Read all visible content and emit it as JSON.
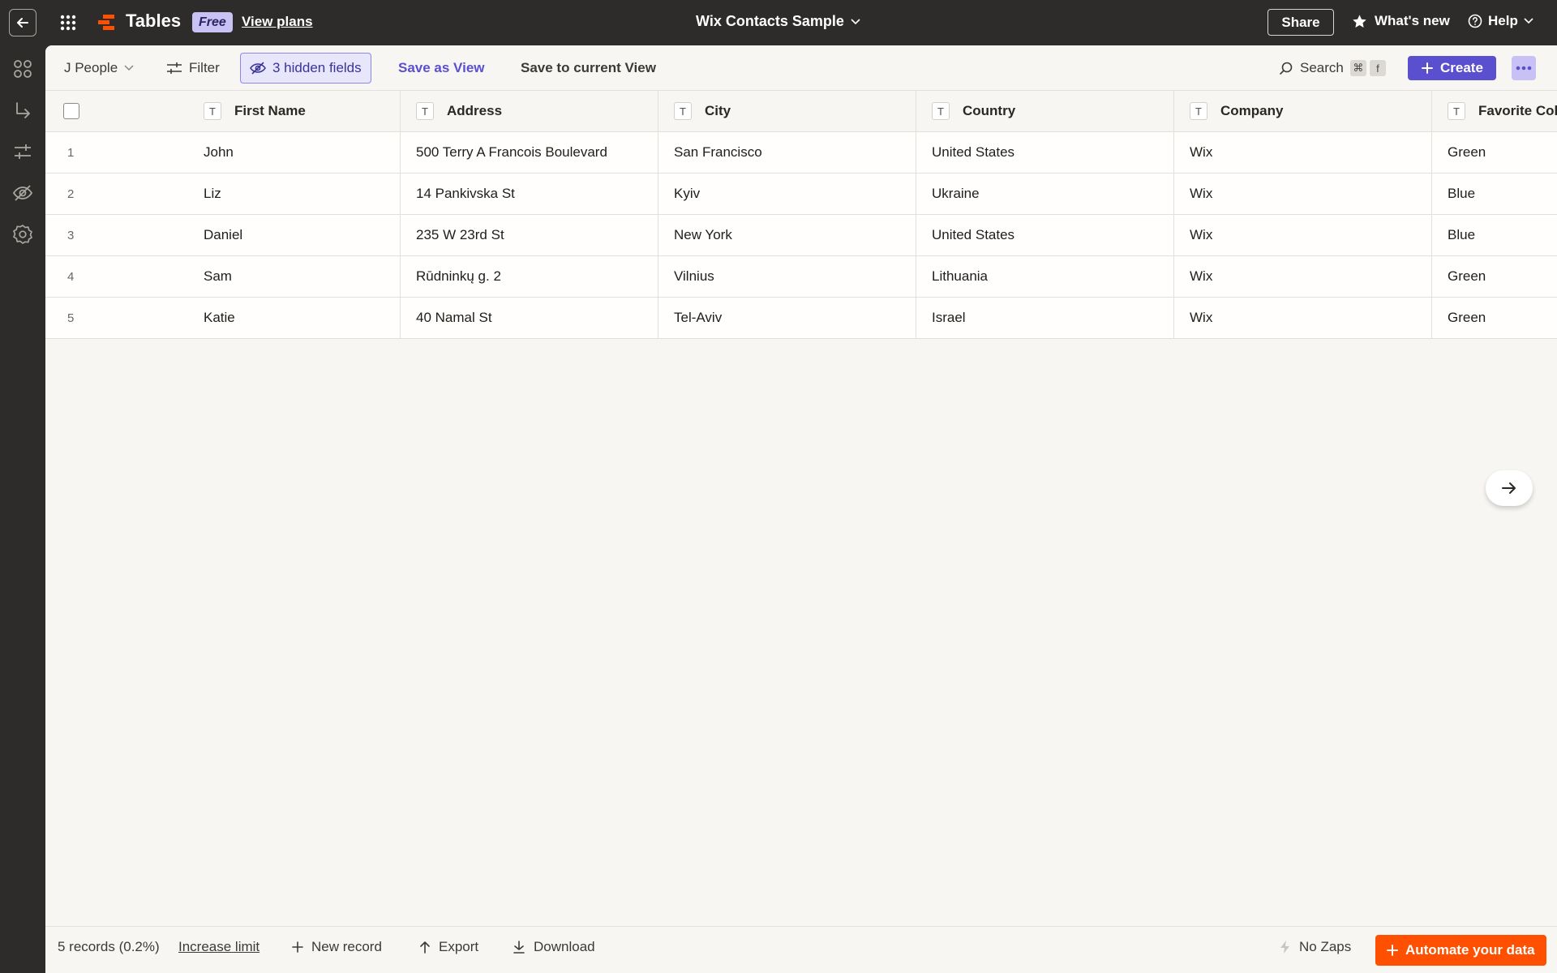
{
  "app": {
    "name": "Tables",
    "plan_badge": "Free",
    "view_plans": "View plans",
    "document_title": "Wix Contacts Sample",
    "share": "Share",
    "whats_new": "What's new",
    "help": "Help"
  },
  "toolbar": {
    "table_name": "J People",
    "filter": "Filter",
    "hidden_fields": "3 hidden fields",
    "save_as_view": "Save as View",
    "save_to_current": "Save to current View",
    "search": "Search",
    "search_key_mod": "⌘",
    "search_key": "f",
    "create": "Create"
  },
  "table": {
    "type_icon": "T",
    "columns": [
      "First Name",
      "Address",
      "City",
      "Country",
      "Company",
      "Favorite Color"
    ],
    "rows": [
      {
        "index": "1",
        "cells": [
          "John",
          "500 Terry A Francois Boulevard",
          "San Francisco",
          "United States",
          "Wix",
          "Green"
        ]
      },
      {
        "index": "2",
        "cells": [
          "Liz",
          "14 Pankivska St",
          "Kyiv",
          "Ukraine",
          "Wix",
          "Blue"
        ]
      },
      {
        "index": "3",
        "cells": [
          "Daniel",
          "235 W 23rd St",
          "New York",
          "United States",
          "Wix",
          "Blue"
        ]
      },
      {
        "index": "4",
        "cells": [
          "Sam",
          "Rūdninkų g. 2",
          "Vilnius",
          "Lithuania",
          "Wix",
          "Green"
        ]
      },
      {
        "index": "5",
        "cells": [
          "Katie",
          "40 Namal St",
          "Tel-Aviv",
          "Israel",
          "Wix",
          "Green"
        ]
      }
    ]
  },
  "footer": {
    "records": "5 records (0.2%)",
    "increase_limit": "Increase limit",
    "new_record": "New record",
    "export": "Export",
    "download": "Download",
    "no_zaps": "No Zaps",
    "automate": "Automate your data"
  },
  "colors": {
    "accent": "#5a4fcf",
    "orange": "#ff4f00",
    "chrome": "#2d2c2a",
    "surface": "#f7f6f3"
  }
}
